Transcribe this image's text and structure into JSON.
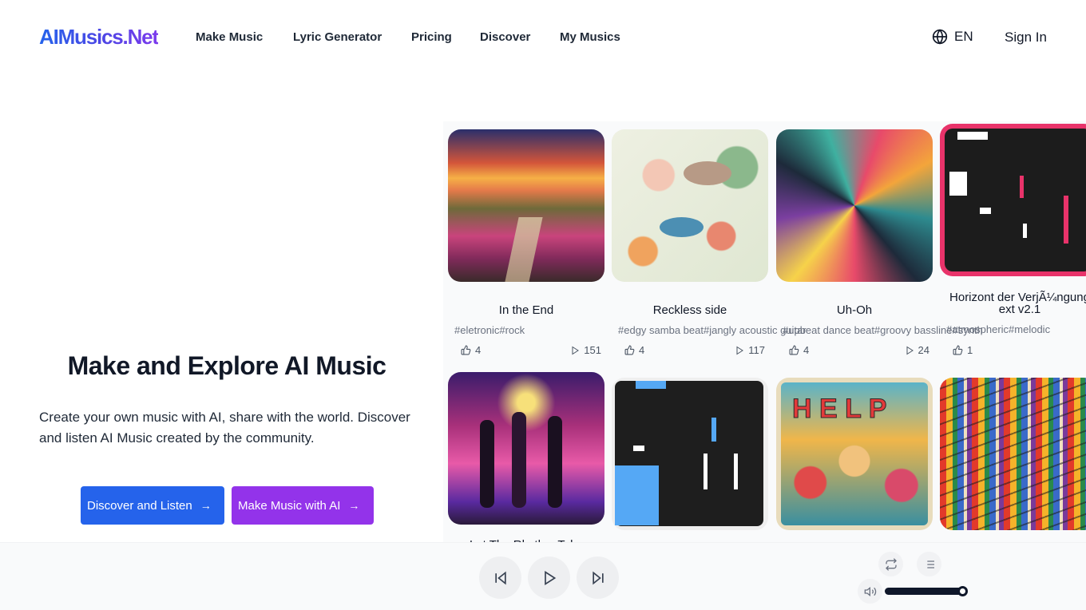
{
  "header": {
    "logo": "AIMusics.Net",
    "nav": [
      "Make Music",
      "Lyric Generator",
      "Pricing",
      "Discover",
      "My Musics"
    ],
    "language": "EN",
    "sign_in": "Sign In"
  },
  "hero": {
    "title": "Make and Explore AI Music",
    "description": "Create your own music with AI, share with the world. Discover and listen AI Music created by the community.",
    "buttons": {
      "discover": "Discover and Listen",
      "make": "Make Music with AI",
      "arrow": "→"
    }
  },
  "songs": [
    {
      "title": "In the End",
      "tags": "#eletronic#rock",
      "likes": "4",
      "plays": "151"
    },
    {
      "title": "Reckless side",
      "tags": "#edgy samba beat#jangly acoustic guitar",
      "likes": "4",
      "plays": "117"
    },
    {
      "title": "Uh-Oh",
      "tags": "#upbeat dance beat#groovy bassline#synth",
      "likes": "4",
      "plays": "24"
    },
    {
      "title": "Horizont der VerjÃ¼ngung ext v2.1",
      "tags": "#atmospheric#melodic",
      "likes": "1",
      "plays": ""
    },
    {
      "title": "Let The Rhythm Take",
      "tags": "",
      "likes": "",
      "plays": ""
    },
    {
      "title": "",
      "tags": "",
      "likes": "",
      "plays": ""
    },
    {
      "title": "",
      "tags": "",
      "likes": "",
      "plays": ""
    },
    {
      "title": "",
      "tags": "",
      "likes": "",
      "plays": ""
    }
  ],
  "player": {
    "volume_percent": 100
  },
  "colors": {
    "primary_blue": "#2563eb",
    "primary_purple": "#9333ea"
  }
}
